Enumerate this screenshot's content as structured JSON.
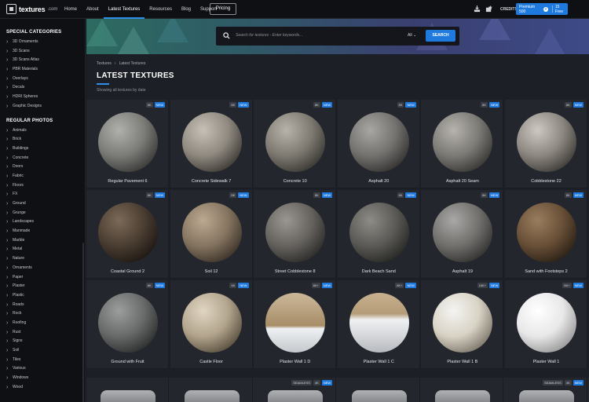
{
  "header": {
    "logo_name": "textures",
    "logo_tld": ".com",
    "nav": [
      "Home",
      "About",
      "Latest Textures",
      "Resources",
      "Blog",
      "Support"
    ],
    "active_nav": "Latest Textures",
    "pricing_label": "Pricing",
    "credits_label": "CREDITS:",
    "premium_label": "Premium 500",
    "free_label": "15 Free",
    "accent_color": "#1f7ae0"
  },
  "sidebar": {
    "special_heading": "SPECIAL CATEGORIES",
    "special": [
      "3D Ornaments",
      "3D Scans",
      "3D Scans Atlas",
      "PBR Materials",
      "Overlays",
      "Decals",
      "HDRI Spheres",
      "Graphic Designs"
    ],
    "regular_heading": "REGULAR PHOTOS",
    "regular": [
      "Animals",
      "Brick",
      "Buildings",
      "Concrete",
      "Doors",
      "Fabric",
      "Floors",
      "FX",
      "Ground",
      "Grunge",
      "Landscapes",
      "Manmade",
      "Marble",
      "Metal",
      "Nature",
      "Ornaments",
      "Paper",
      "Plaster",
      "Plastic",
      "Roads",
      "Rock",
      "Roofing",
      "Rust",
      "Signs",
      "Soil",
      "Tiles",
      "Various",
      "Windows",
      "Wood"
    ]
  },
  "search": {
    "placeholder": "Search for textures - Enter keywords...",
    "scope": "All",
    "button": "SEARCH"
  },
  "main": {
    "breadcrumb": [
      "Textures",
      "Latest Textures"
    ],
    "title": "LATEST TEXTURES",
    "subtitle": "Showing all textures by date"
  },
  "textures": [
    {
      "name": "Regular Pavement 6",
      "res": "8K",
      "new": "NEW"
    },
    {
      "name": "Concrete Sidewalk 7",
      "res": "8K",
      "new": "NEW"
    },
    {
      "name": "Concrete 10",
      "res": "8K",
      "new": "NEW"
    },
    {
      "name": "Asphalt 20",
      "res": "8K",
      "new": "NEW"
    },
    {
      "name": "Asphalt 20 Seam",
      "res": "8K",
      "new": "NEW"
    },
    {
      "name": "Cobblestone 22",
      "res": "8K",
      "new": "NEW"
    },
    {
      "name": "Coastal Ground 2",
      "res": "8K",
      "new": "NEW"
    },
    {
      "name": "Soil 12",
      "res": "8K",
      "new": "NEW"
    },
    {
      "name": "Street Cobblestone 8",
      "res": "8K",
      "new": "NEW"
    },
    {
      "name": "Dark Beach Sand",
      "res": "8K",
      "new": "NEW"
    },
    {
      "name": "Asphalt 19",
      "res": "8K",
      "new": "NEW"
    },
    {
      "name": "Sand with Footsteps 2",
      "res": "8K",
      "new": "NEW"
    },
    {
      "name": "Ground with Fruit",
      "res": "8K",
      "new": "NEW"
    },
    {
      "name": "Castle Floor",
      "res": "4K",
      "new": "NEW"
    },
    {
      "name": "Plaster Wall 1 D",
      "res": "8K+",
      "new": "NEW"
    },
    {
      "name": "Plaster Wall 1 C",
      "res": "8K+",
      "new": "NEW"
    },
    {
      "name": "Plaster Wall 1 B",
      "res": "16K+",
      "new": "NEW"
    },
    {
      "name": "Plaster Wall 1",
      "res": "8K+",
      "new": "NEW"
    }
  ],
  "row4_badges": {
    "seamless": "SEAMLESS",
    "res": "4K",
    "new": "NEW"
  }
}
